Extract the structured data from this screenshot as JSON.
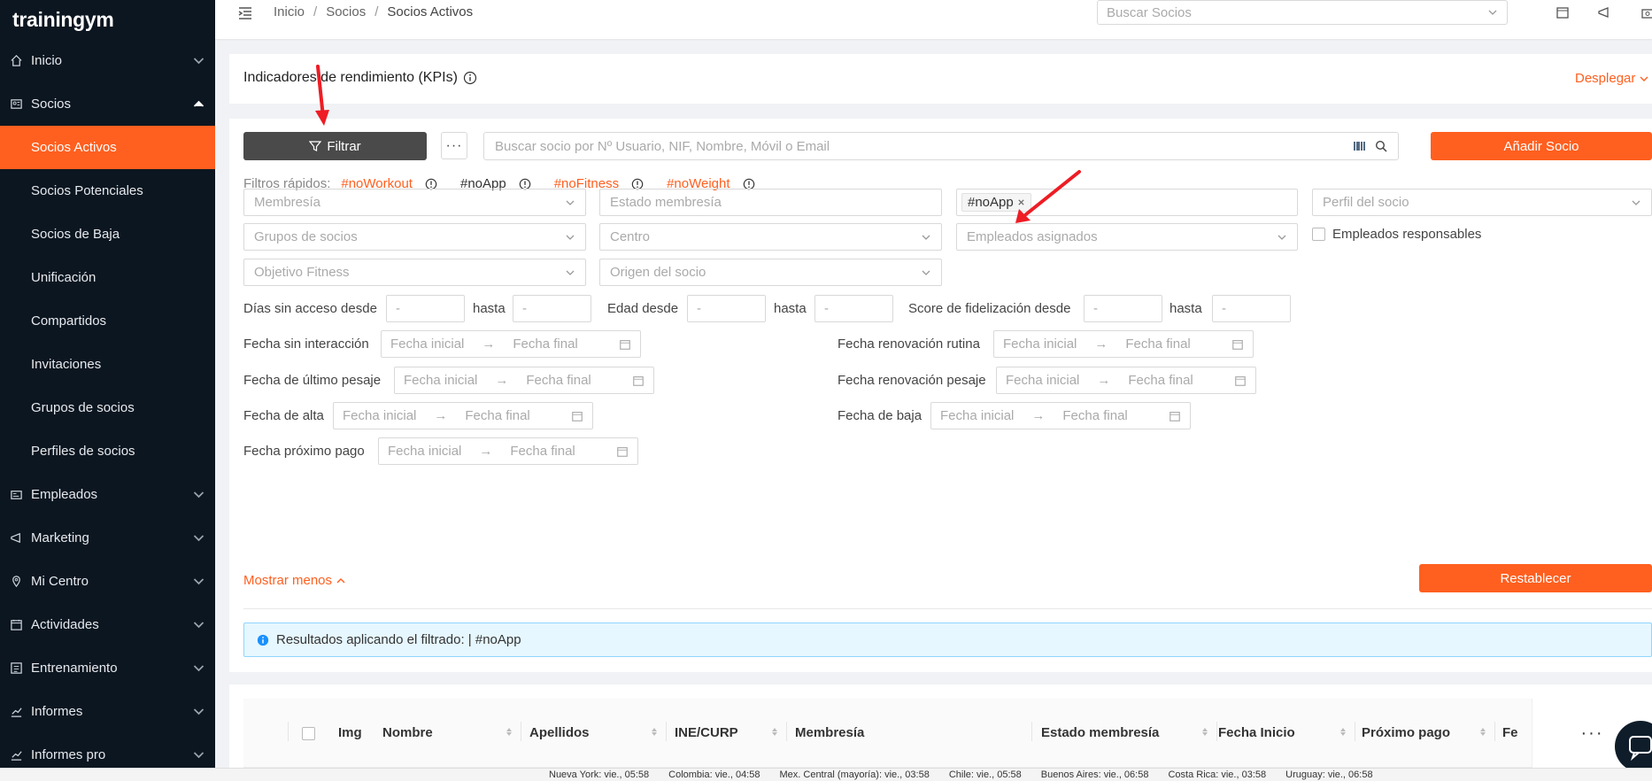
{
  "app": {
    "logo": "trainingym"
  },
  "sidebar": {
    "groups": [
      {
        "label": "Inicio",
        "icon": "home-icon"
      },
      {
        "label": "Socios",
        "icon": "members-icon"
      },
      {
        "label": "Empleados",
        "icon": "employees-icon"
      },
      {
        "label": "Marketing",
        "icon": "megaphone-icon"
      },
      {
        "label": "Mi Centro",
        "icon": "location-icon"
      },
      {
        "label": "Actividades",
        "icon": "calendar-icon"
      },
      {
        "label": "Entrenamiento",
        "icon": "training-icon"
      },
      {
        "label": "Informes",
        "icon": "chart-icon"
      },
      {
        "label": "Informes pro",
        "icon": "chart-pro-icon"
      }
    ],
    "socios_items": [
      "Socios Activos",
      "Socios Potenciales",
      "Socios de Baja",
      "Unificación",
      "Compartidos",
      "Invitaciones",
      "Grupos de socios",
      "Perfiles de socios"
    ],
    "active_item": "Socios Activos"
  },
  "topbar": {
    "breadcrumb": [
      "Inicio",
      "Socios",
      "Socios Activos"
    ],
    "search_placeholder": "Buscar Socios"
  },
  "kpi": {
    "title": "Indicadores de rendimiento (KPIs)",
    "expand_label": "Desplegar"
  },
  "toolbar": {
    "filter_label": "Filtrar",
    "more_label": "···",
    "search_placeholder": "Buscar socio por Nº Usuario, NIF, Nombre, Móvil o Email",
    "add_label": "Añadir Socio"
  },
  "quick_filters": {
    "label": "Filtros rápidos:",
    "chips": [
      "#noWorkout",
      "#noApp",
      "#noFitness",
      "#noWeight"
    ]
  },
  "filters": {
    "membresia": "Membresía",
    "estado_membresia": "Estado membresía",
    "selected_tag": "#noApp",
    "perfil_socio": "Perfil del socio",
    "grupos_socios": "Grupos de socios",
    "centro": "Centro",
    "empleados_asignados": "Empleados asignados",
    "empleados_responsables": "Empleados responsables",
    "objetivo_fitness": "Objetivo Fitness",
    "origen_socio": "Origen del socio",
    "dias_sin_acceso": "Días sin acceso desde",
    "hasta": "hasta",
    "edad_desde": "Edad desde",
    "score_fidelizacion": "Score de fidelización desde",
    "dash": "-",
    "fecha_inicial": "Fecha inicial",
    "fecha_final": "Fecha final",
    "fecha_sin_interaccion": "Fecha sin interacción",
    "fecha_renovacion_rutina": "Fecha renovación rutina",
    "fecha_ultimo_pesaje": "Fecha de último pesaje",
    "fecha_renovacion_pesaje": "Fecha renovación pesaje",
    "fecha_alta": "Fecha de alta",
    "fecha_baja": "Fecha de baja",
    "fecha_proximo_pago": "Fecha próximo pago",
    "show_less": "Mostrar menos",
    "reset": "Restablecer"
  },
  "alert": {
    "text": "Resultados aplicando el filtrado: | #noApp"
  },
  "table": {
    "headers": [
      "Img",
      "Nombre",
      "Apellidos",
      "INE/CURP",
      "Membresía",
      "Estado membresía",
      "Fecha Inicio",
      "Próximo pago",
      "Fe"
    ],
    "more_label": "···"
  },
  "statusbar": {
    "items": [
      "Nueva York: vie., 05:58",
      "Colombia: vie., 04:58",
      "Mex. Central (mayoría): vie., 03:58",
      "Chile: vie., 05:58",
      "Buenos Aires: vie., 06:58",
      "Costa Rica: vie., 03:58",
      "Uruguay: vie., 06:58"
    ]
  },
  "colors": {
    "accent": "#ff5f1f",
    "sidebar_bg": "#0c1620",
    "annotation": "#ee1c24"
  }
}
